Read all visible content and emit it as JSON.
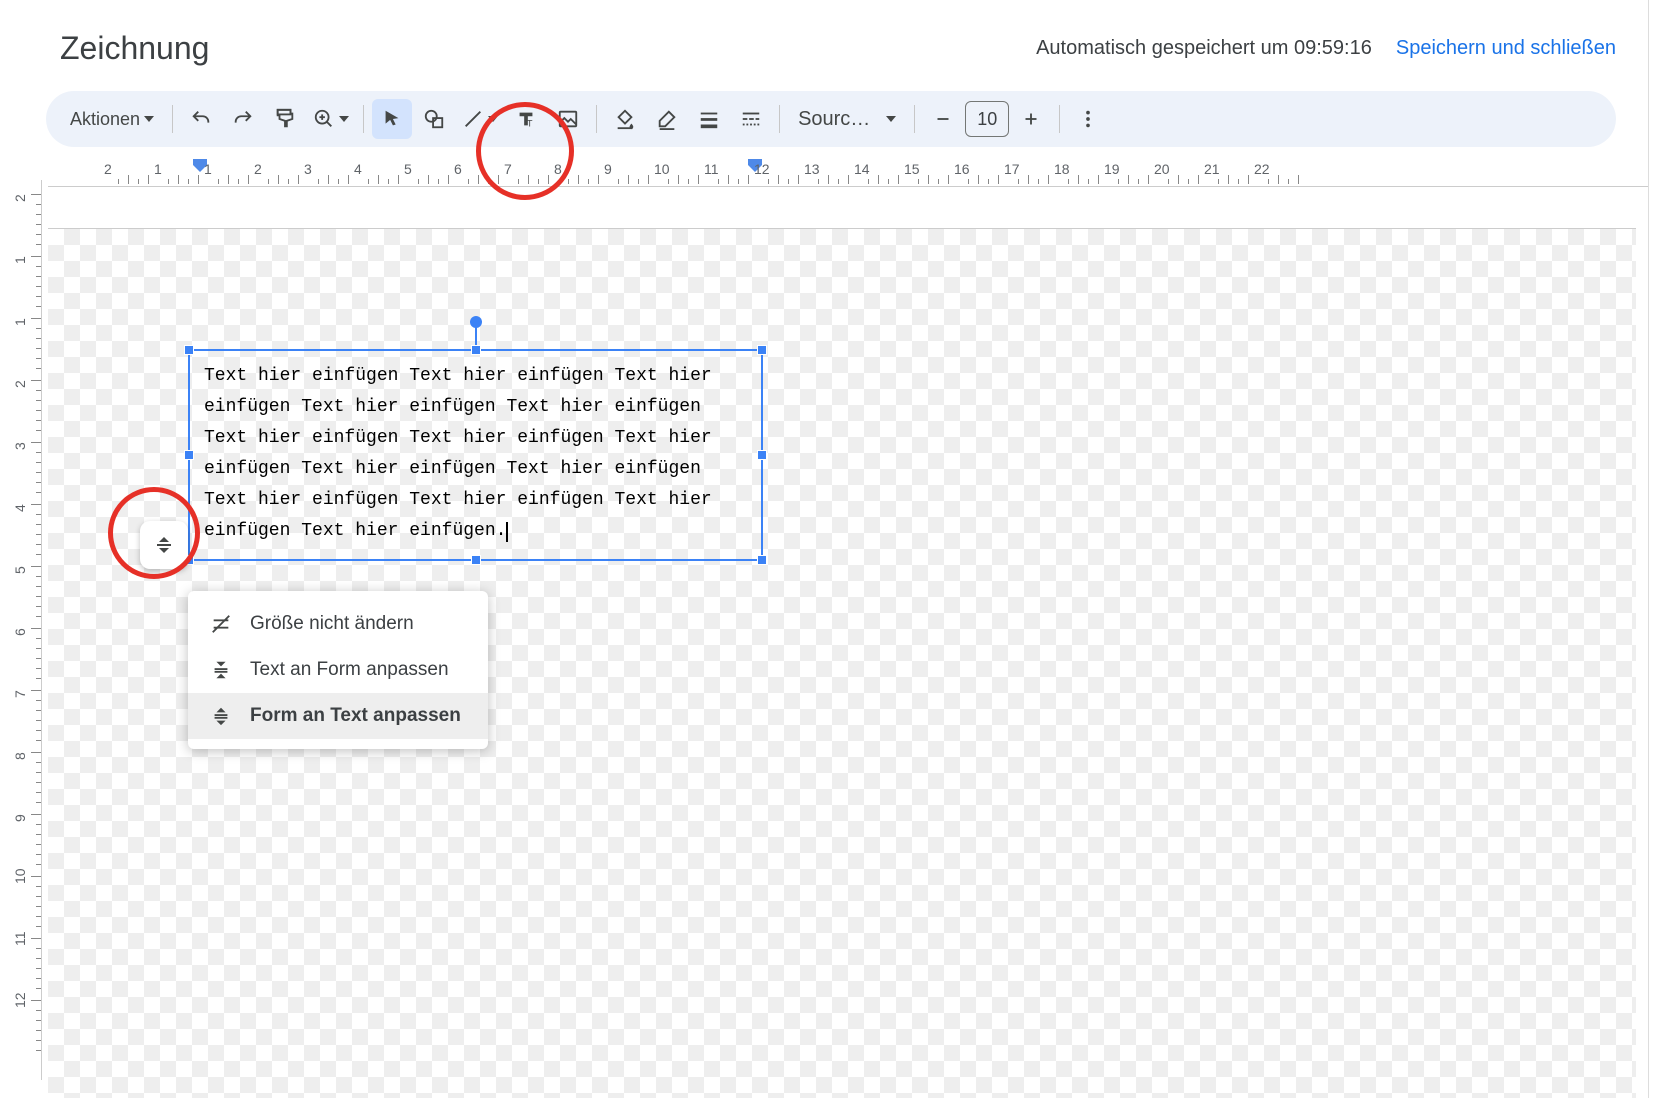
{
  "header": {
    "title": "Zeichnung",
    "autosave": "Automatisch gespeichert um 09:59:16",
    "save_close": "Speichern und schließen"
  },
  "toolbar": {
    "actions": "Aktionen",
    "font": "Sourc…",
    "font_size": "10"
  },
  "textbox": {
    "content": "Text hier einfügen Text hier einfügen Text hier einfügen Text hier einfügen Text hier einfügen Text hier einfügen Text hier einfügen Text hier einfügen Text hier einfügen Text hier einfügen Text hier einfügen Text hier einfügen Text hier einfügen Text hier einfügen."
  },
  "menu": {
    "opt1": "Größe nicht ändern",
    "opt2": "Text an Form anpassen",
    "opt3": "Form an Text anpassen"
  },
  "ruler_h": [
    2,
    1,
    1,
    2,
    3,
    4,
    5,
    6,
    7,
    8,
    9,
    10,
    11,
    12,
    13,
    14,
    15,
    16,
    17,
    18,
    19,
    20,
    21,
    22
  ],
  "ruler_v": [
    2,
    1,
    1,
    2,
    3,
    4,
    5,
    6,
    7,
    8,
    9,
    10,
    11,
    12
  ]
}
